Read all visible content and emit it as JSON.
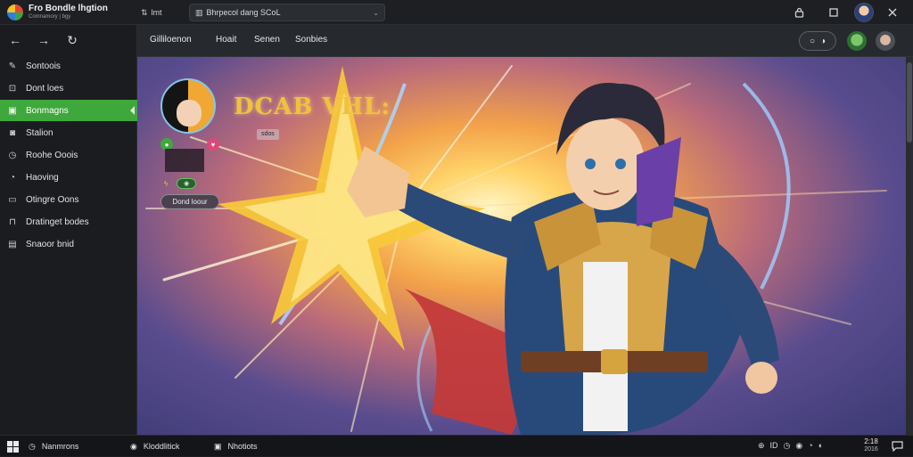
{
  "colors": {
    "accent": "#3fa83c",
    "topbar": "#1d1f22",
    "sidebar": "#1b1c1f",
    "title_gold": "#f0c23c"
  },
  "app": {
    "title": "Fro Bondle lhgtion",
    "subtitle": "Comnamory | bgy"
  },
  "topbar": {
    "tab_label": "lmt",
    "url_text": "Bhrpecol dang  SCoL",
    "icons": {
      "tab": "tab-icon",
      "lock": "lock-icon",
      "maximize": "maximize-icon",
      "close": "close-icon"
    }
  },
  "nav": {
    "back": "←",
    "forward": "→",
    "refresh": "↻"
  },
  "sidebar": {
    "items": [
      {
        "label": "Sontoois",
        "icon": "wrench-icon",
        "glyph": "✎",
        "active": false
      },
      {
        "label": "Dont loes",
        "icon": "bookmark-icon",
        "glyph": "⊡",
        "active": false
      },
      {
        "label": "Bonmagns",
        "icon": "image-icon",
        "glyph": "▣",
        "active": true
      },
      {
        "label": "Stalion",
        "icon": "chat-icon",
        "glyph": "◙",
        "active": false
      },
      {
        "label": "Roohe Ooois",
        "icon": "clock-icon",
        "glyph": "◷",
        "active": false
      },
      {
        "label": "Haoving",
        "icon": "moon-icon",
        "glyph": "◔",
        "active": false
      },
      {
        "label": "Otingre Oons",
        "icon": "folder-icon",
        "glyph": "▭",
        "active": false
      },
      {
        "label": "Dratinget bodes",
        "icon": "lock-icon",
        "glyph": "⊓",
        "active": false
      },
      {
        "label": "Snaoor bnid",
        "icon": "grid-icon",
        "glyph": "▤",
        "active": false
      }
    ]
  },
  "content_tabs": [
    {
      "label": "Gilliloenon"
    },
    {
      "label": "Hoait"
    },
    {
      "label": "Senen"
    },
    {
      "label": "Sonbies"
    }
  ],
  "hero": {
    "title": "DCAB VHL:",
    "badge": "sdos",
    "button_label": "Dond loour"
  },
  "taskbar": {
    "items": [
      {
        "label": "Nanmrons",
        "icon": "clock-icon",
        "glyph": "◷"
      },
      {
        "label": "Kloddlitick",
        "icon": "record-icon",
        "glyph": "◉"
      },
      {
        "label": "Nhotiots",
        "icon": "window-icon",
        "glyph": "▣"
      }
    ],
    "tray_glyphs": [
      "⊕",
      "ID",
      "◷",
      "◉",
      "◔",
      "◐"
    ],
    "clock_time": "2:18",
    "clock_date": "2016"
  }
}
